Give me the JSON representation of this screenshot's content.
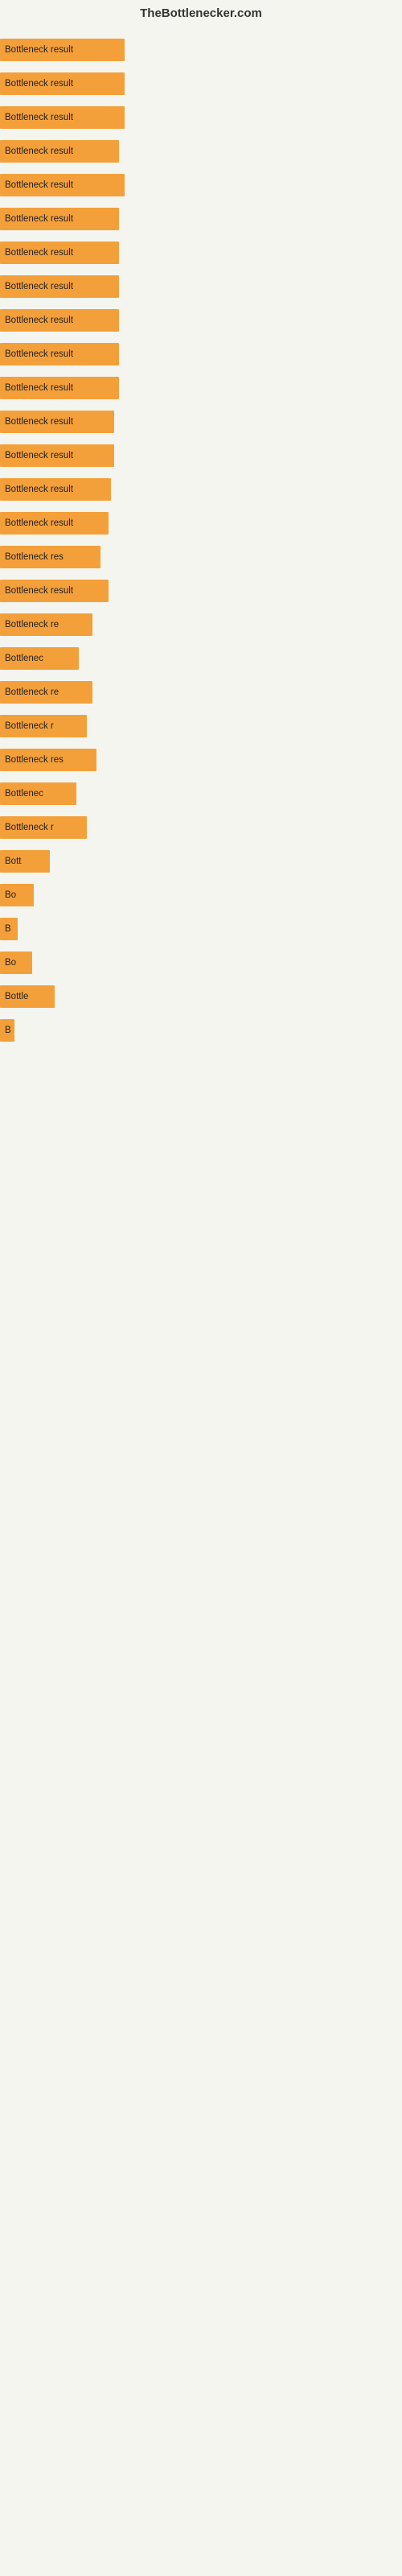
{
  "header": {
    "title": "TheBottlenecker.com"
  },
  "bars": [
    {
      "label": "Bottleneck result",
      "width": 155
    },
    {
      "label": "Bottleneck result",
      "width": 155
    },
    {
      "label": "Bottleneck result",
      "width": 155
    },
    {
      "label": "Bottleneck result",
      "width": 148
    },
    {
      "label": "Bottleneck result",
      "width": 155
    },
    {
      "label": "Bottleneck result",
      "width": 148
    },
    {
      "label": "Bottleneck result",
      "width": 148
    },
    {
      "label": "Bottleneck result",
      "width": 148
    },
    {
      "label": "Bottleneck result",
      "width": 148
    },
    {
      "label": "Bottleneck result",
      "width": 148
    },
    {
      "label": "Bottleneck result",
      "width": 148
    },
    {
      "label": "Bottleneck result",
      "width": 142
    },
    {
      "label": "Bottleneck result",
      "width": 142
    },
    {
      "label": "Bottleneck result",
      "width": 138
    },
    {
      "label": "Bottleneck result",
      "width": 135
    },
    {
      "label": "Bottleneck res",
      "width": 125
    },
    {
      "label": "Bottleneck result",
      "width": 135
    },
    {
      "label": "Bottleneck re",
      "width": 115
    },
    {
      "label": "Bottlenec",
      "width": 98
    },
    {
      "label": "Bottleneck re",
      "width": 115
    },
    {
      "label": "Bottleneck r",
      "width": 108
    },
    {
      "label": "Bottleneck res",
      "width": 120
    },
    {
      "label": "Bottlenec",
      "width": 95
    },
    {
      "label": "Bottleneck r",
      "width": 108
    },
    {
      "label": "Bott",
      "width": 62
    },
    {
      "label": "Bo",
      "width": 42
    },
    {
      "label": "B",
      "width": 22
    },
    {
      "label": "Bo",
      "width": 40
    },
    {
      "label": "Bottle",
      "width": 68
    },
    {
      "label": "B",
      "width": 18
    }
  ]
}
